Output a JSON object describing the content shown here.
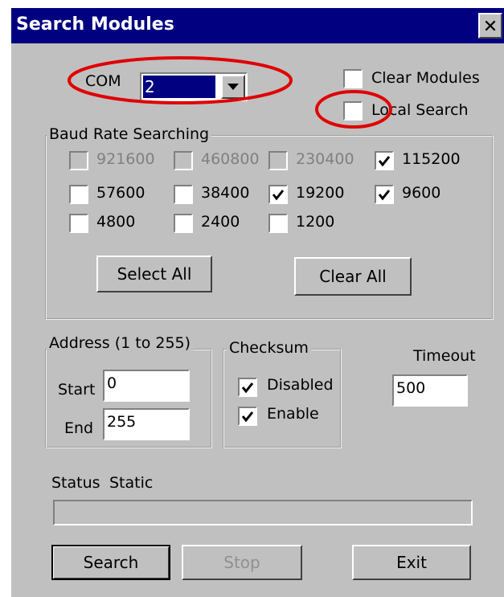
{
  "window": {
    "title": "Search Modules",
    "close_glyph": "✕"
  },
  "com": {
    "label": "COM",
    "value": "2"
  },
  "options": {
    "clear_modules": "Clear Modules",
    "local_search": "Local Search"
  },
  "baud": {
    "title": "Baud Rate Searching",
    "rates": [
      {
        "label": "921600",
        "checked": false,
        "enabled": false
      },
      {
        "label": "460800",
        "checked": false,
        "enabled": false
      },
      {
        "label": "230400",
        "checked": false,
        "enabled": false
      },
      {
        "label": "115200",
        "checked": true,
        "enabled": true
      },
      {
        "label": "57600",
        "checked": false,
        "enabled": true
      },
      {
        "label": "38400",
        "checked": false,
        "enabled": true
      },
      {
        "label": "19200",
        "checked": true,
        "enabled": true
      },
      {
        "label": "9600",
        "checked": true,
        "enabled": true
      },
      {
        "label": "4800",
        "checked": false,
        "enabled": true
      },
      {
        "label": "2400",
        "checked": false,
        "enabled": true
      },
      {
        "label": "1200",
        "checked": false,
        "enabled": true
      }
    ],
    "select_all": "Select All",
    "clear_all": "Clear All"
  },
  "address": {
    "title": "Address (1 to 255)",
    "start_label": "Start",
    "start_value": "0",
    "end_label": "End",
    "end_value": "255"
  },
  "checksum": {
    "title": "Checksum",
    "disabled_label": "Disabled",
    "disabled_checked": true,
    "enable_label": "Enable",
    "enable_checked": true
  },
  "timeout": {
    "label": "Timeout",
    "value": "500"
  },
  "status": {
    "label": "Status",
    "value": "Static"
  },
  "buttons": {
    "search": "Search",
    "stop": "Stop",
    "exit": "Exit"
  },
  "annotations": {
    "color": "#e00000"
  }
}
